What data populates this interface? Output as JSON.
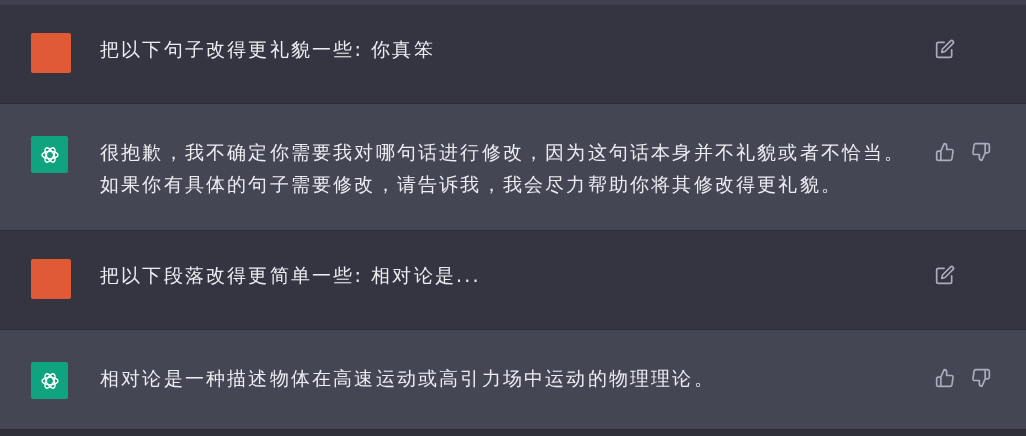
{
  "messages": [
    {
      "kind": "user",
      "text": "把以下句子改得更礼貌一些: 你真笨"
    },
    {
      "kind": "assistant",
      "text": "很抱歉，我不确定你需要我对哪句话进行修改，因为这句话本身并不礼貌或者不恰当。如果你有具体的句子需要修改，请告诉我，我会尽力帮助你将其修改得更礼貌。"
    },
    {
      "kind": "user",
      "text": "把以下段落改得更简单一些: 相对论是..."
    },
    {
      "kind": "assistant",
      "text": "相对论是一种描述物体在高速运动或高引力场中运动的物理理论。"
    }
  ]
}
